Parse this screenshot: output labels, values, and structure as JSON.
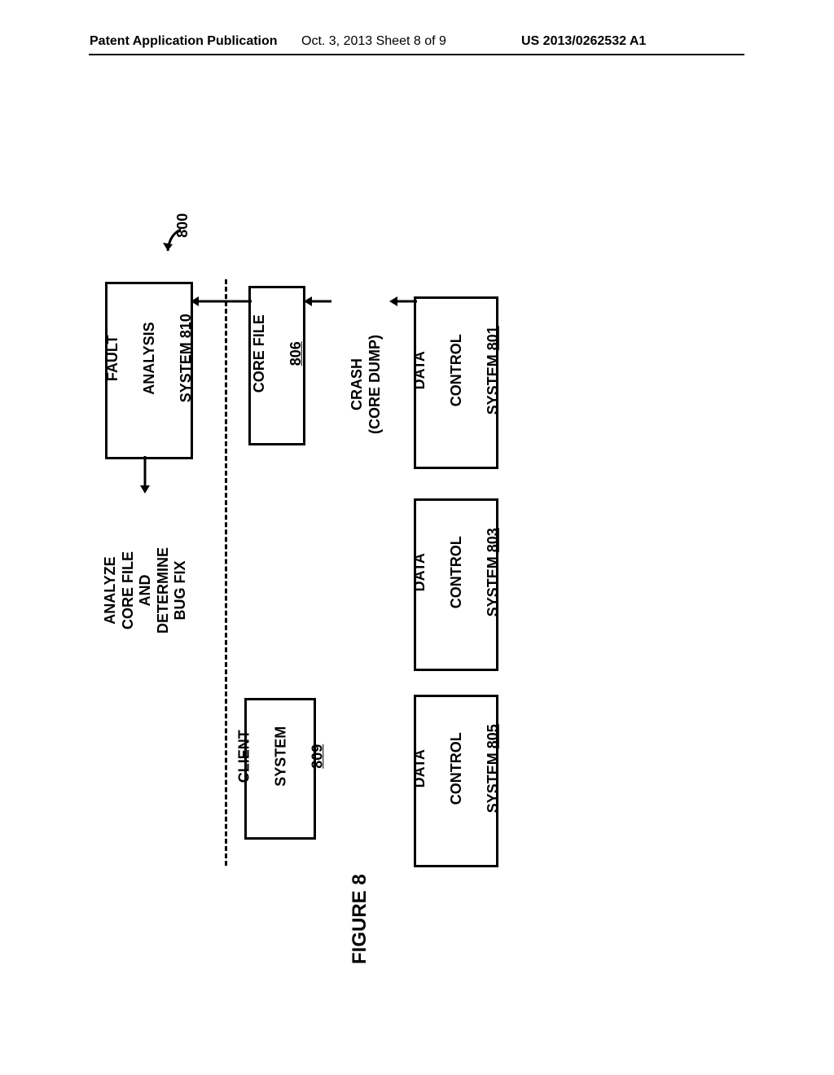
{
  "header": {
    "left": "Patent Application Publication",
    "middle": "Oct. 3, 2013   Sheet 8 of 9",
    "right": "US 2013/0262532 A1"
  },
  "diagram": {
    "ref_num": "800",
    "boxes": {
      "dcs1": {
        "line1": "DATA",
        "line2": "CONTROL",
        "line3": "SYSTEM ",
        "num": "801"
      },
      "dcs3": {
        "line1": "DATA",
        "line2": "CONTROL",
        "line3": "SYSTEM ",
        "num": "803"
      },
      "dcs5": {
        "line1": "DATA",
        "line2": "CONTROL",
        "line3": "SYSTEM ",
        "num": "805"
      },
      "corefile": {
        "line1": "CORE FILE",
        "num": "806"
      },
      "client": {
        "line1": "CLIENT",
        "line2": "SYSTEM",
        "num": "809"
      },
      "fault": {
        "line1": "FAULT",
        "line2": "ANALYSIS",
        "line3": "SYSTEM ",
        "num": "810"
      }
    },
    "labels": {
      "crash": "CRASH\n(CORE DUMP)",
      "analyze": "ANALYZE\nCORE FILE\nAND\nDETERMINE\nBUG FIX"
    },
    "caption": "FIGURE 8"
  }
}
